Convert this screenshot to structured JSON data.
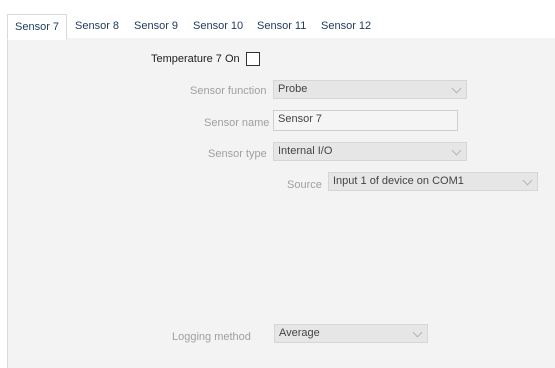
{
  "tabs": [
    {
      "label": "Sensor 7"
    },
    {
      "label": "Sensor 8"
    },
    {
      "label": "Sensor 9"
    },
    {
      "label": "Sensor 10"
    },
    {
      "label": "Sensor 11"
    },
    {
      "label": "Sensor 12"
    }
  ],
  "form": {
    "temperature_on_label": "Temperature 7 On",
    "temperature_on_checked": false,
    "sensor_function_label": "Sensor function",
    "sensor_function_value": "Probe",
    "sensor_name_label": "Sensor name",
    "sensor_name_value": "Sensor 7",
    "sensor_type_label": "Sensor type",
    "sensor_type_value": "Internal I/O",
    "source_label": "Source",
    "source_value": "Input 1 of device on COM1",
    "logging_method_label": "Logging method",
    "logging_method_value": "Average"
  },
  "colors": {
    "tab_text": "#1e395b",
    "panel_bg": "#f3f3f3",
    "disabled_text": "#a0a0a0"
  }
}
